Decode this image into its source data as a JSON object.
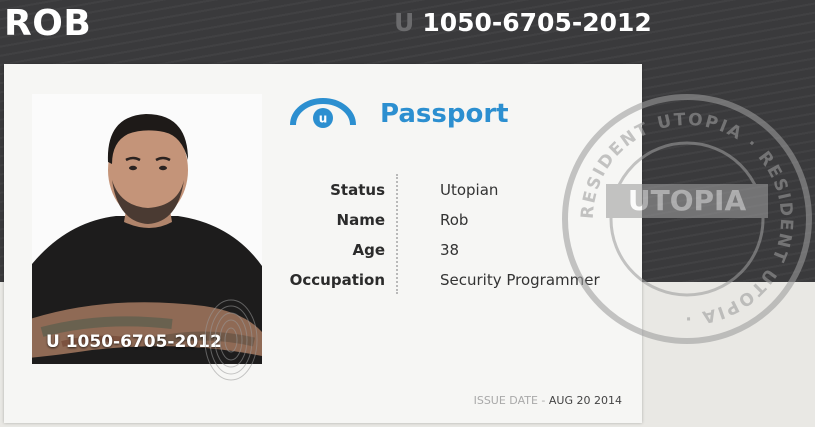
{
  "header": {
    "name": "ROB",
    "id_prefix": "U",
    "id_number": "1050-6705-2012"
  },
  "card": {
    "title": "Passport",
    "logo_icon": "utopia-logo-icon",
    "photo_id": "U 1050-6705-2012",
    "fields": [
      {
        "label": "Status",
        "value": "Utopian"
      },
      {
        "label": "Name",
        "value": "Rob"
      },
      {
        "label": "Age",
        "value": "38"
      },
      {
        "label": "Occupation",
        "value": "Security Programmer"
      }
    ],
    "issue": {
      "label": "ISSUE DATE",
      "separator": "-",
      "date": "AUG 20 2014"
    }
  },
  "stamp": {
    "text": "RESIDENT UTOPIA · RESIDENT UTOPIA ·",
    "center_text": "UTOPIA"
  },
  "colors": {
    "accent": "#2c8fd0",
    "header_background": "#3a3a3c",
    "card_background": "#f6f6f4"
  }
}
